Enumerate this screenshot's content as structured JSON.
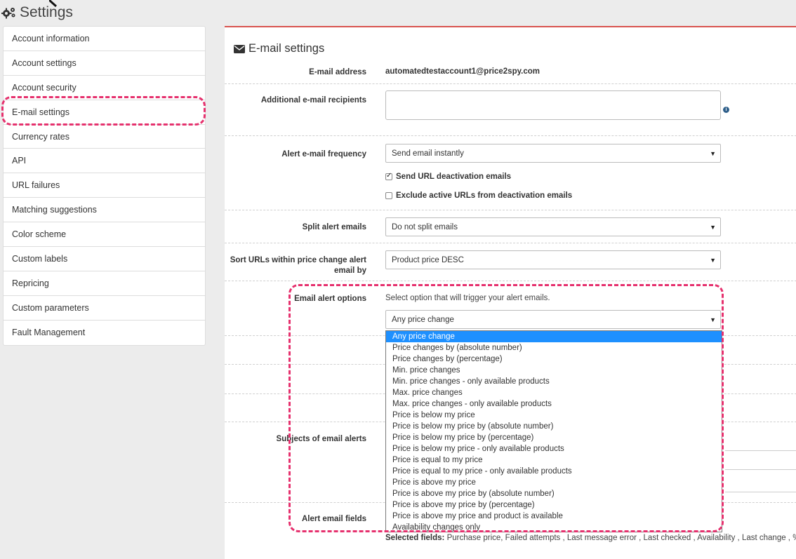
{
  "page": {
    "title": "Settings",
    "title_icon": "gears-icon"
  },
  "sidebar": {
    "items": [
      {
        "label": "Account information"
      },
      {
        "label": "Account settings"
      },
      {
        "label": "Account security"
      },
      {
        "label": "E-mail settings",
        "active": true
      },
      {
        "label": "Currency rates"
      },
      {
        "label": "API"
      },
      {
        "label": "URL failures"
      },
      {
        "label": "Matching suggestions"
      },
      {
        "label": "Color scheme"
      },
      {
        "label": "Custom labels"
      },
      {
        "label": "Repricing"
      },
      {
        "label": "Custom parameters"
      },
      {
        "label": "Fault Management"
      }
    ]
  },
  "panel": {
    "title": "E-mail settings",
    "title_icon": "envelope-icon",
    "accent_color": "#d9534f"
  },
  "form": {
    "email_address": {
      "label": "E-mail address",
      "value": "automatedtestaccount1@price2spy.com"
    },
    "additional_recipients": {
      "label": "Additional e-mail recipients",
      "value": ""
    },
    "alert_frequency": {
      "label": "Alert e-mail frequency",
      "value": "Send email instantly"
    },
    "send_deactivation": {
      "label": "Send URL deactivation emails",
      "checked": true
    },
    "exclude_active": {
      "label": "Exclude active URLs from deactivation emails",
      "checked": false
    },
    "split_alert": {
      "label": "Split alert emails",
      "value": "Do not split emails"
    },
    "sort_urls": {
      "label": "Sort URLs within price change alert email by",
      "value": "Product price DESC"
    },
    "alert_options": {
      "label": "Email alert options",
      "hint": "Select option that will trigger your alert emails.",
      "value": "Any price change",
      "options": [
        "Any price change",
        "Price changes by (absolute number)",
        "Price changes by (percentage)",
        "Min. price changes",
        "Min. price changes - only available products",
        "Max. price changes",
        "Max. price changes - only available products",
        "Price is below my price",
        "Price is below my price by (absolute number)",
        "Price is below my price by (percentage)",
        "Price is below my price - only available products",
        "Price is equal to my price",
        "Price is equal to my price - only available products",
        "Price is above my price",
        "Price is above my price by (absolute number)",
        "Price is above my price by (percentage)",
        "Price is above my price and product is available",
        "Availability changes only"
      ],
      "selected_index": 0
    },
    "subjects_label": "Subjects of email alerts",
    "alert_fields": {
      "label": "Alert email fields",
      "selected_prefix": "Selected fields:",
      "selected_values": "Purchase price, Failed attempts , Last message error , Last checked , Availability , Last change , % diff"
    }
  },
  "highlight_color": "#e6316e"
}
